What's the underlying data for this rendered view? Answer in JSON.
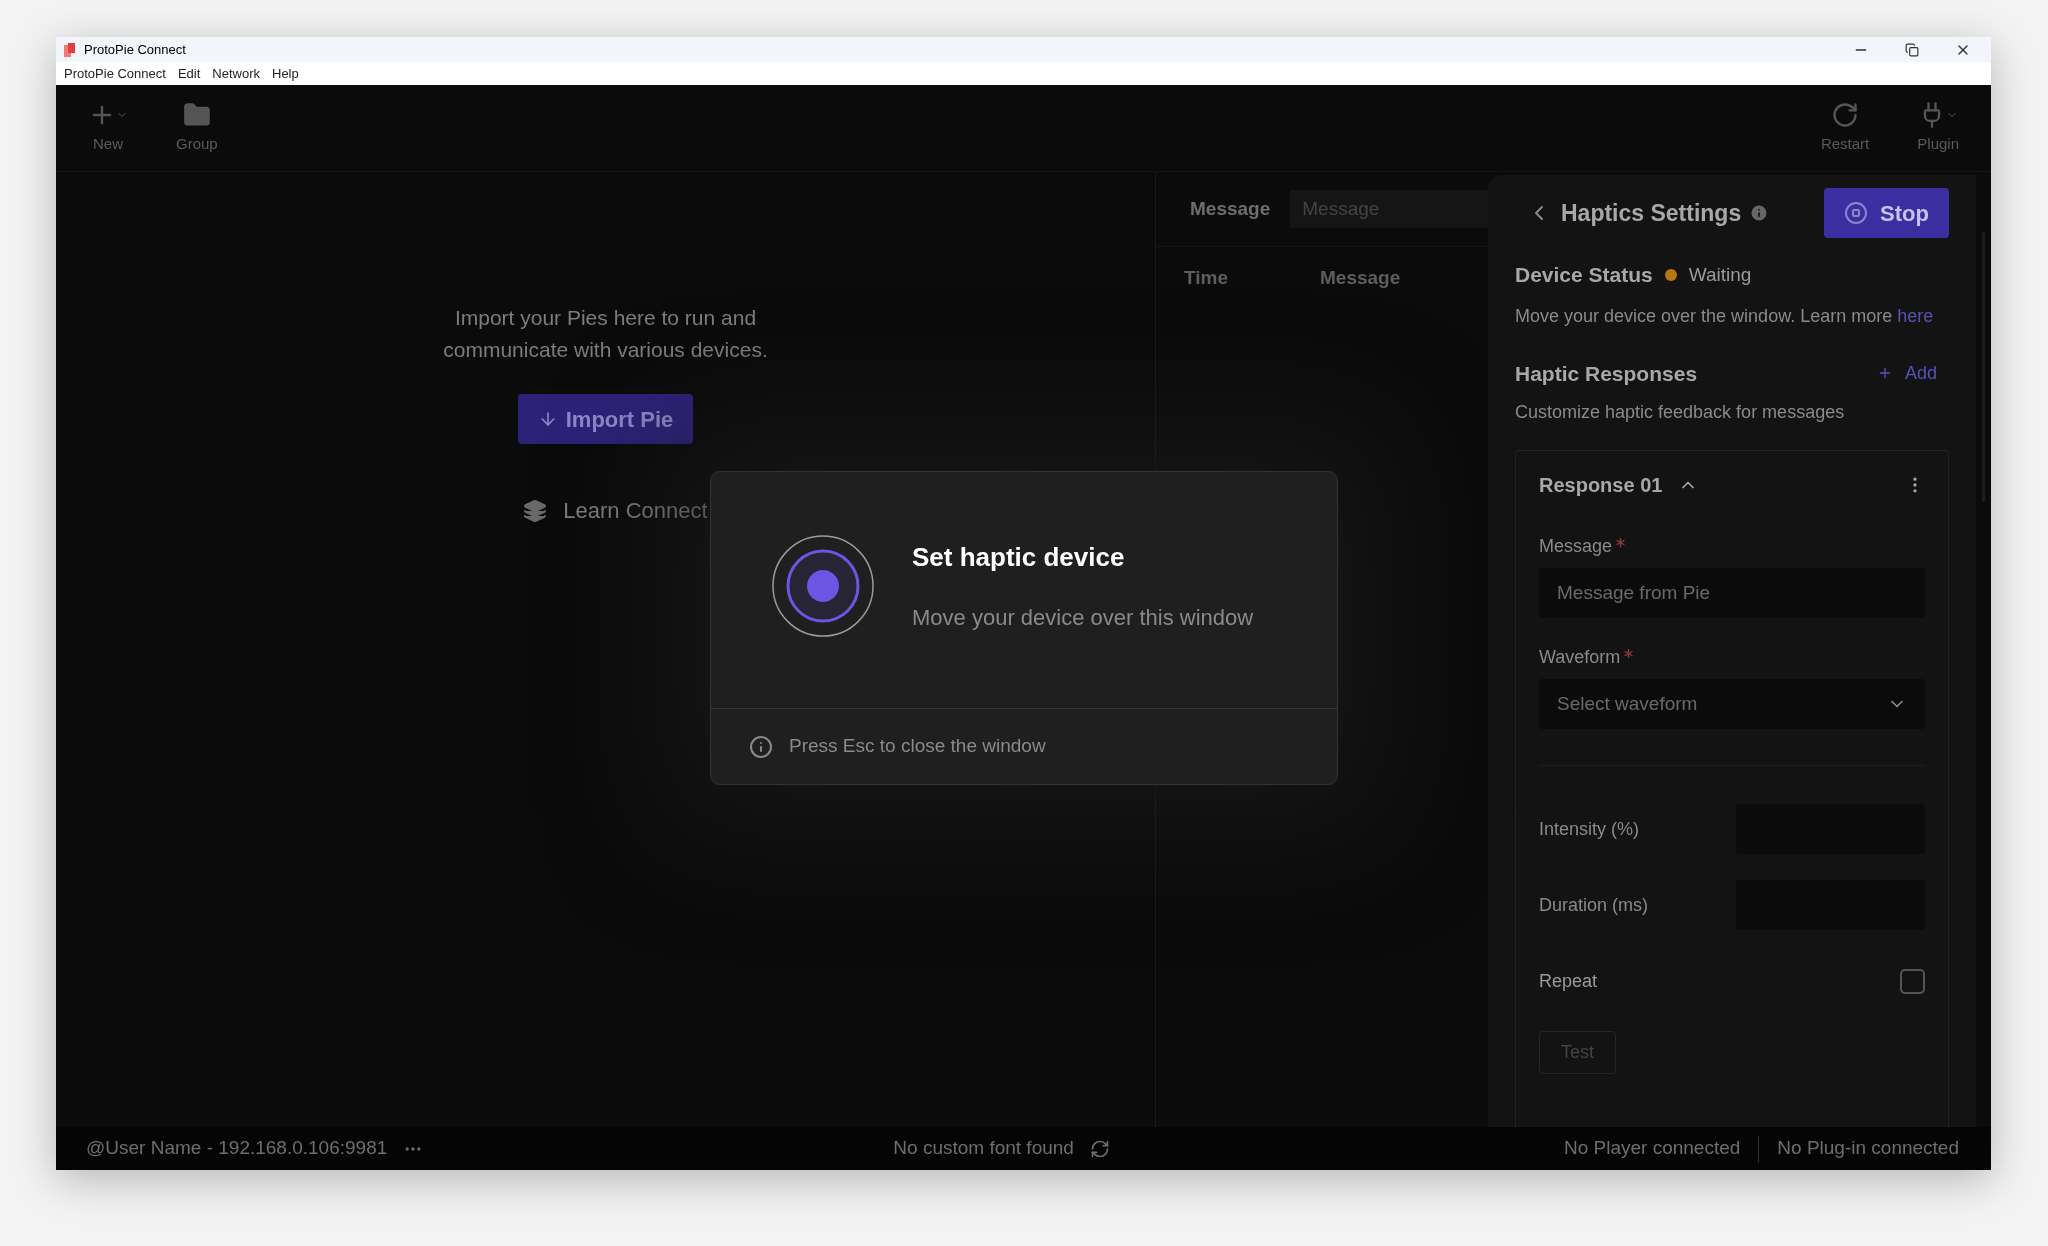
{
  "window": {
    "title": "ProtoPie Connect"
  },
  "menu": [
    "ProtoPie Connect",
    "Edit",
    "Network",
    "Help"
  ],
  "toolbar": {
    "left": [
      {
        "kind": "new",
        "label": "New"
      },
      {
        "kind": "group",
        "label": "Group"
      }
    ],
    "right": [
      {
        "kind": "restart",
        "label": "Restart"
      },
      {
        "kind": "plugin",
        "label": "Plugin"
      }
    ]
  },
  "empty_state": {
    "text": "Import your Pies here to run and communicate with various devices.",
    "import_button": "Import Pie",
    "learn_link": "Learn Connect"
  },
  "message_log": {
    "filter_label": "Message",
    "filter_placeholder": "Message",
    "columns": [
      "Time",
      "Message"
    ]
  },
  "haptics": {
    "title": "Haptics Settings",
    "stop_button": "Stop",
    "device_status": {
      "label": "Device Status",
      "status": "Waiting"
    },
    "hint": "Move your device over the window. Learn more",
    "hint_link": "here",
    "responses_title": "Haptic Responses",
    "add_button": "Add",
    "responses_subtitle": "Customize haptic feedback for messages",
    "response": {
      "title": "Response 01",
      "expanded": true,
      "message": {
        "label": "Message",
        "required": true,
        "placeholder": "Message from Pie"
      },
      "waveform": {
        "label": "Waveform",
        "required": true,
        "placeholder": "Select waveform"
      },
      "intensity": {
        "label": "Intensity (%)"
      },
      "duration": {
        "label": "Duration (ms)"
      },
      "repeat": {
        "label": "Repeat",
        "checked": false
      },
      "test_button": "Test"
    }
  },
  "modal": {
    "title": "Set haptic device",
    "text": "Move your device over this window",
    "footer": "Press Esc to close the window"
  },
  "status_bar": {
    "user": "@User Name - 192.168.0.106:9981",
    "font_status": "No custom font found",
    "player": "No Player connected",
    "plugin": "No Plug-in connected"
  }
}
